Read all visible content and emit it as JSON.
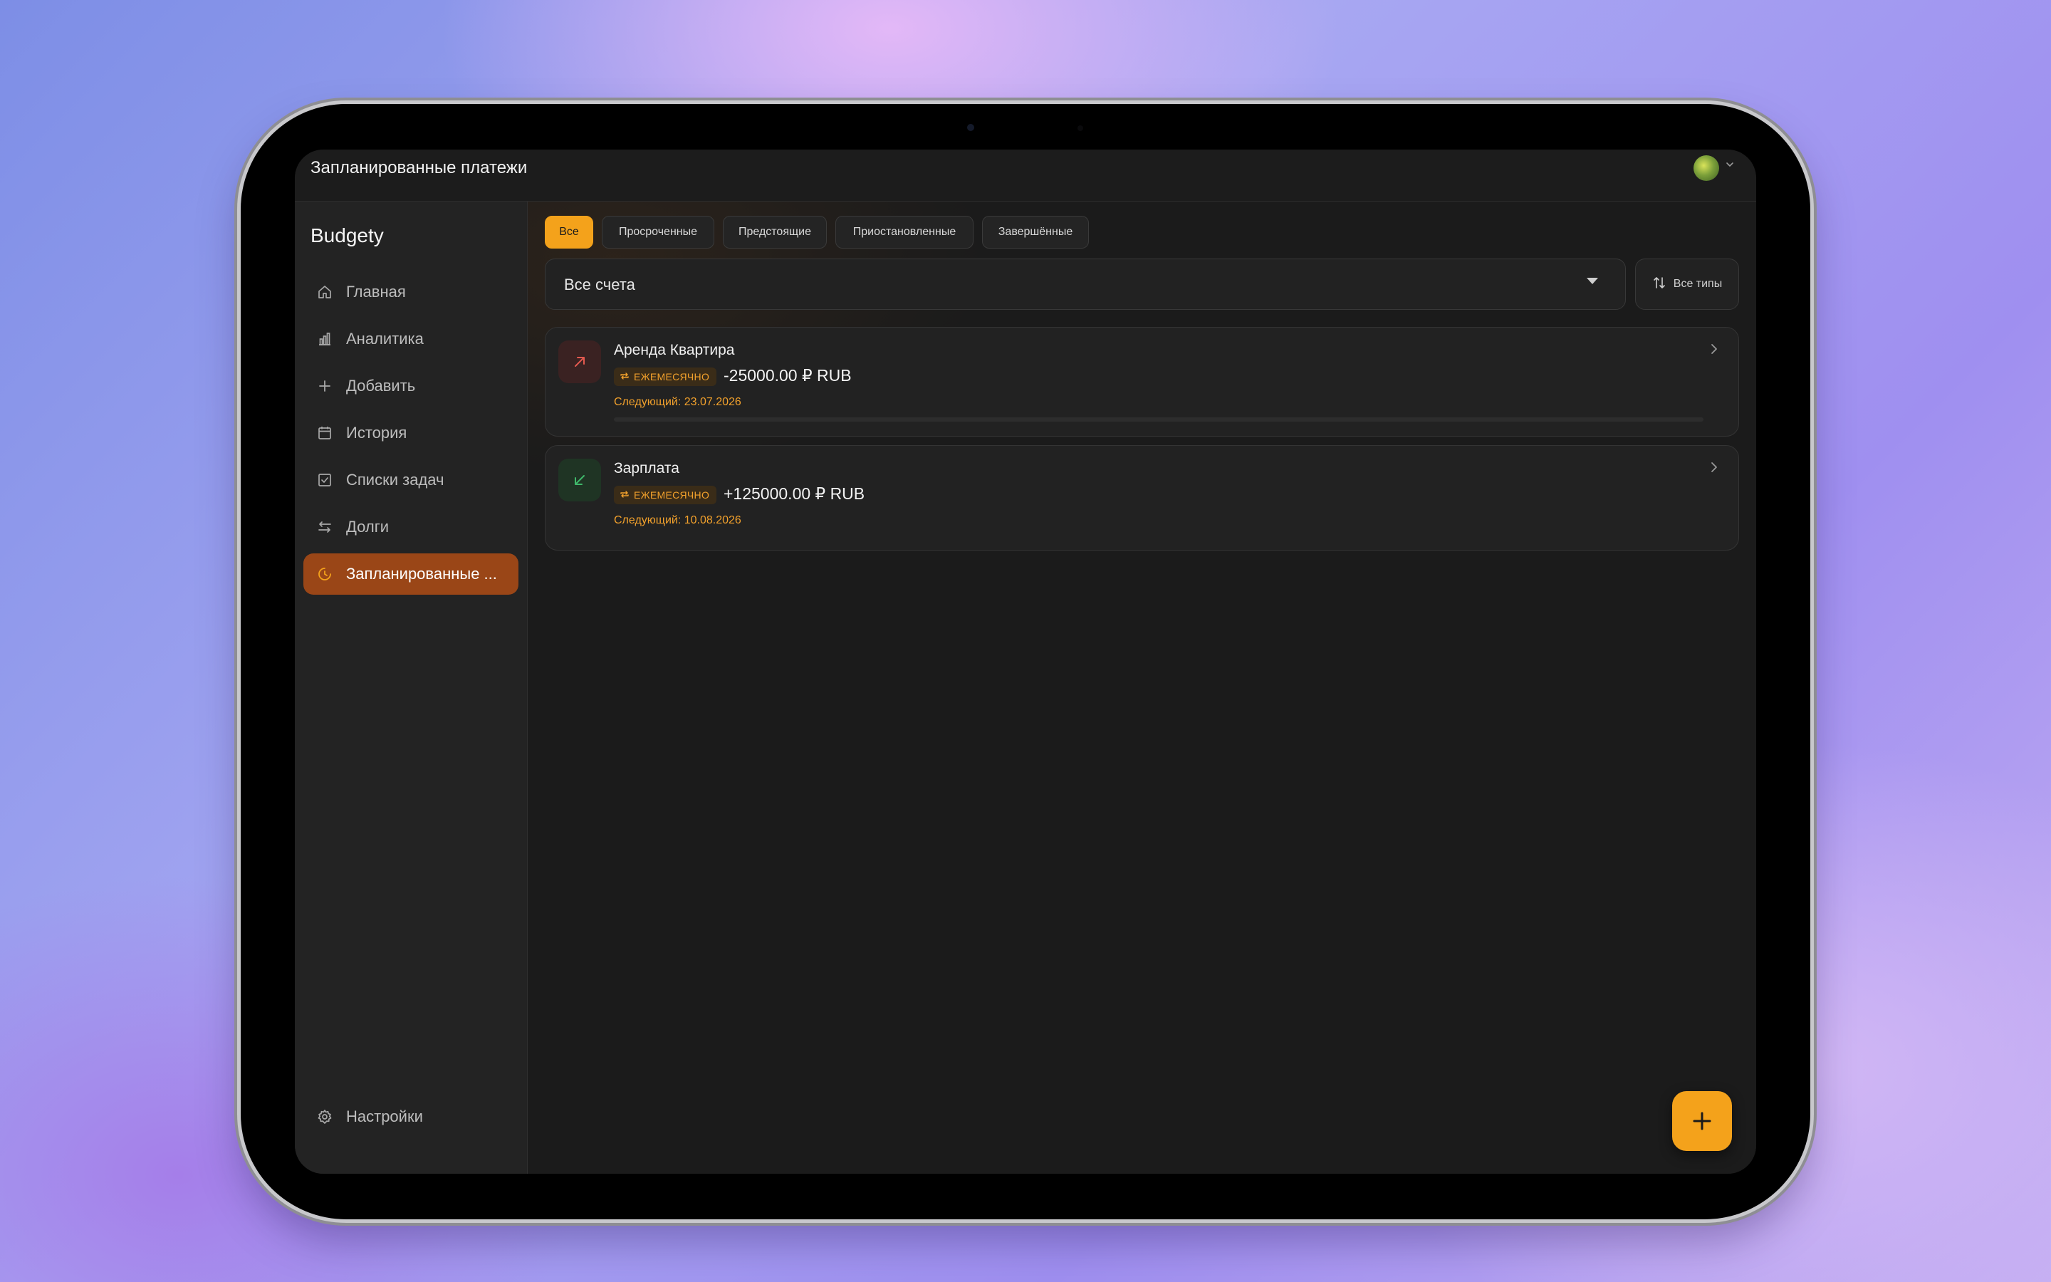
{
  "topbar": {
    "title": "Запланированные платежи"
  },
  "sidebar": {
    "brand": "Budgety",
    "items": [
      {
        "label": "Главная",
        "icon": "home-icon"
      },
      {
        "label": "Аналитика",
        "icon": "bar-chart-icon"
      },
      {
        "label": "Добавить",
        "icon": "plus-icon"
      },
      {
        "label": "История",
        "icon": "calendar-icon"
      },
      {
        "label": "Списки задач",
        "icon": "checkbox-icon"
      },
      {
        "label": "Долги",
        "icon": "arrows-swap-icon"
      },
      {
        "label": "Запланированные ...",
        "icon": "clock-icon",
        "active": true
      }
    ],
    "settings": {
      "label": "Настройки",
      "icon": "gear-icon"
    }
  },
  "filters": {
    "tabs": [
      "Все",
      "Просроченные",
      "Предстоящие",
      "Приостановленные",
      "Завершённые"
    ],
    "active_tab": "Все",
    "account_select": "Все счета",
    "types_button": "Все типы"
  },
  "payments": [
    {
      "title": "Аренда Квартира",
      "frequency": "ЕЖЕМЕСЯЧНО",
      "amount": "-25000.00 ₽ RUB",
      "next": "Следующий: 23.07.2026",
      "direction": "expense",
      "icon": "arrow-up-right-icon"
    },
    {
      "title": "Зарплата",
      "frequency": "ЕЖЕМЕСЯЧНО",
      "amount": "+125000.00 ₽ RUB",
      "next": "Следующий: 10.08.2026",
      "direction": "income",
      "icon": "arrow-down-left-icon"
    }
  ],
  "colors": {
    "accent": "#f4a21b",
    "active_nav": "#9a4617",
    "expense": "#e2594f",
    "income": "#3fb86a"
  }
}
